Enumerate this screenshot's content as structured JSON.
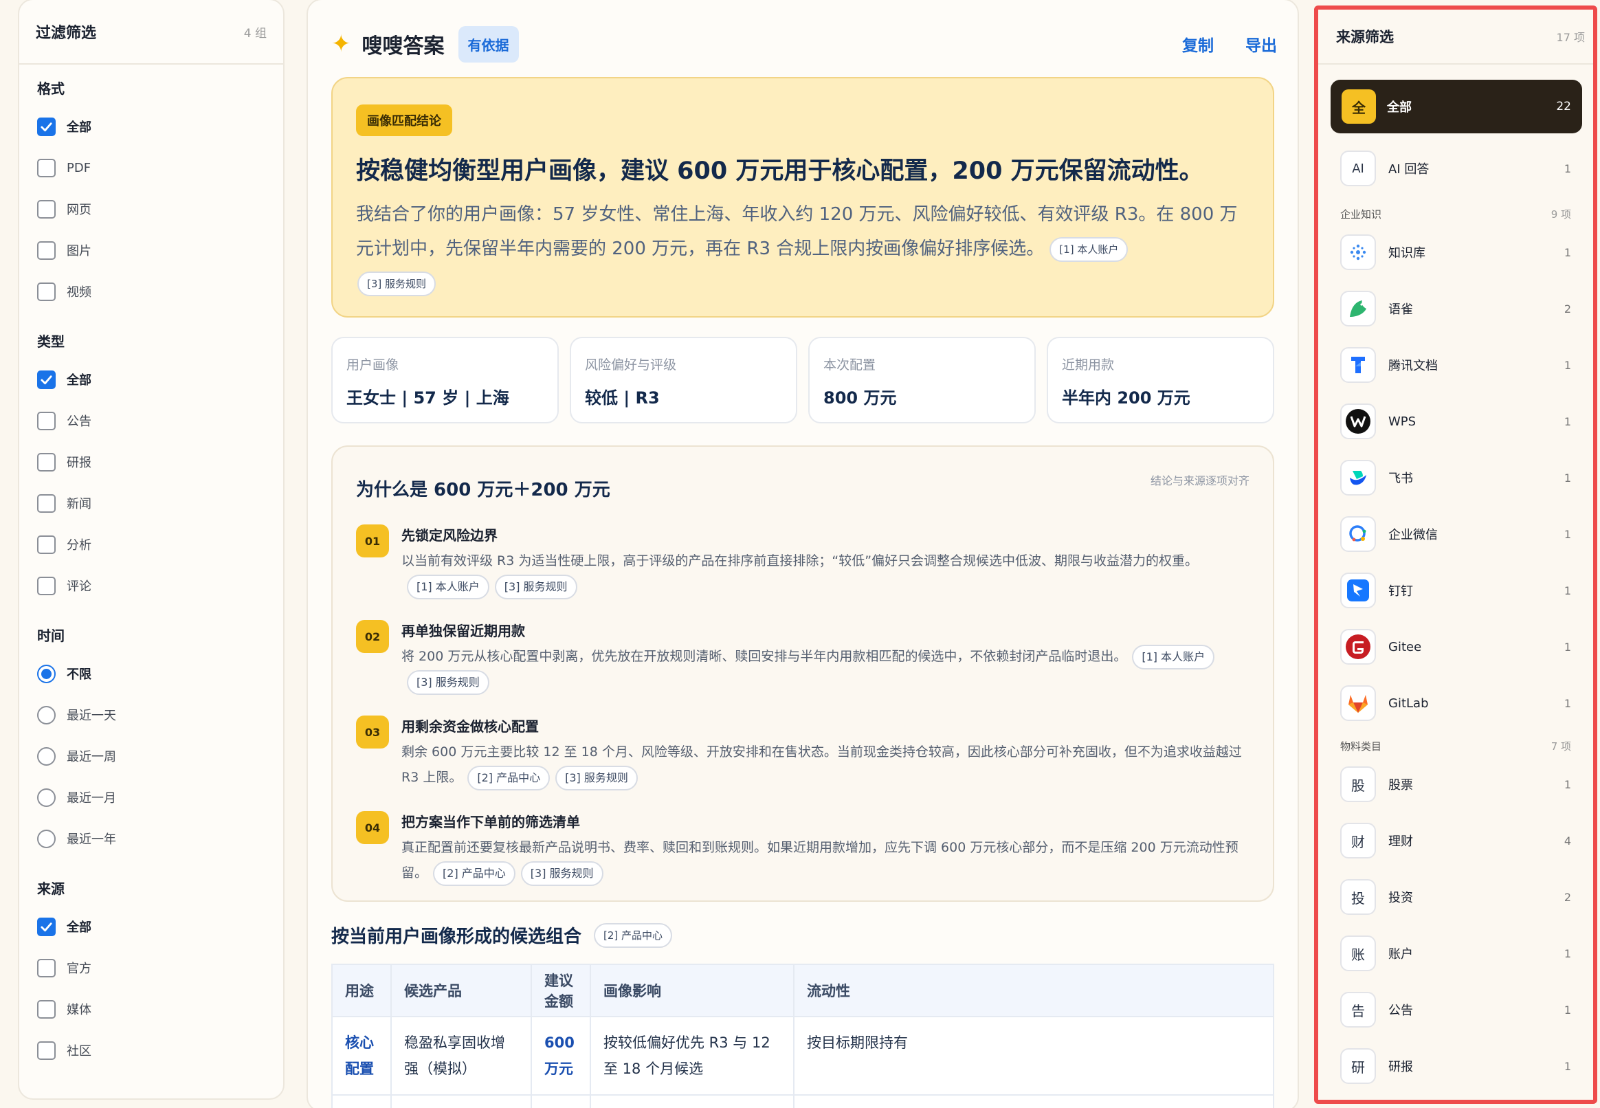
{
  "filters": {
    "title": "过滤筛选",
    "count": "4 组",
    "groups": [
      {
        "title": "格式",
        "kind": "checkbox",
        "options": [
          {
            "label": "全部",
            "checked": true
          },
          {
            "label": "PDF",
            "checked": false
          },
          {
            "label": "网页",
            "checked": false
          },
          {
            "label": "图片",
            "checked": false
          },
          {
            "label": "视频",
            "checked": false
          }
        ]
      },
      {
        "title": "类型",
        "kind": "checkbox",
        "options": [
          {
            "label": "全部",
            "checked": true
          },
          {
            "label": "公告",
            "checked": false
          },
          {
            "label": "研报",
            "checked": false
          },
          {
            "label": "新闻",
            "checked": false
          },
          {
            "label": "分析",
            "checked": false
          },
          {
            "label": "评论",
            "checked": false
          }
        ]
      },
      {
        "title": "时间",
        "kind": "radio",
        "options": [
          {
            "label": "不限",
            "checked": true
          },
          {
            "label": "最近一天",
            "checked": false
          },
          {
            "label": "最近一周",
            "checked": false
          },
          {
            "label": "最近一月",
            "checked": false
          },
          {
            "label": "最近一年",
            "checked": false
          }
        ]
      },
      {
        "title": "来源",
        "kind": "checkbox",
        "options": [
          {
            "label": "全部",
            "checked": true
          },
          {
            "label": "官方",
            "checked": false
          },
          {
            "label": "媒体",
            "checked": false
          },
          {
            "label": "社区",
            "checked": false
          }
        ]
      }
    ]
  },
  "header": {
    "title": "嗖嗖答案",
    "evidence_badge": "有依据",
    "copy_label": "复制",
    "export_label": "导出"
  },
  "conclusion": {
    "tag": "画像匹配结论",
    "headline": "按稳健均衡型用户画像，建议 600 万元用于核心配置，200 万元保留流动性。",
    "body": "我结合了你的用户画像：57 岁女性、常住上海、年收入约 120 万元、风险偏好较低、有效评级 R3。在 800 万元计划中，先保留半年内需要的 200 万元，再在 R3 合规上限内按画像偏好排序候选。",
    "citations": [
      "[1] 本人账户",
      "[3] 服务规则"
    ]
  },
  "cards": [
    {
      "label": "用户画像",
      "value": "王女士 | 57 岁 | 上海"
    },
    {
      "label": "风险偏好与评级",
      "value": "较低 | R3"
    },
    {
      "label": "本次配置",
      "value": "800 万元"
    },
    {
      "label": "近期用款",
      "value": "半年内 200 万元"
    }
  ],
  "why": {
    "title": "为什么是 600 万元＋200 万元",
    "note": "结论与来源逐项对齐",
    "steps": [
      {
        "num": "01",
        "title": "先锁定风险边界",
        "body": "以当前有效评级 R3 为适当性硬上限，高于评级的产品在排序前直接排除；“较低”偏好只会调整合规候选中低波、期限与收益潜力的权重。",
        "cites": [
          "[1] 本人账户",
          "[3] 服务规则"
        ]
      },
      {
        "num": "02",
        "title": "再单独保留近期用款",
        "body": "将 200 万元从核心配置中剥离，优先放在开放规则清晰、赎回安排与半年内用款相匹配的候选中，不依赖封闭产品临时退出。",
        "cites": [
          "[1] 本人账户",
          "[3] 服务规则"
        ]
      },
      {
        "num": "03",
        "title": "用剩余资金做核心配置",
        "body": "剩余 600 万元主要比较 12 至 18 个月、风险等级、开放安排和在售状态。当前现金类持仓较高，因此核心部分可补充固收，但不为追求收益越过 R3 上限。",
        "cites": [
          "[2] 产品中心",
          "[3] 服务规则"
        ]
      },
      {
        "num": "04",
        "title": "把方案当作下单前的筛选清单",
        "body": "真正配置前还要复核最新产品说明书、费率、赎回和到账规则。如果近期用款增加，应先下调 600 万元核心部分，而不是压缩 200 万元流动性预留。",
        "cites": [
          "[2] 产品中心",
          "[3] 服务规则"
        ]
      }
    ]
  },
  "table": {
    "title": "按当前用户画像形成的候选组合",
    "cite": "[2] 产品中心",
    "columns": [
      "用途",
      "候选产品",
      "建议金额",
      "画像影响",
      "流动性"
    ],
    "rows": [
      [
        "核心配置",
        "稳盈私享固收增强（模拟）",
        "600 万元",
        "按较低偏好优先 R3 与 12 至 18 个月候选",
        "按目标期限持有"
      ]
    ]
  },
  "sources": {
    "title": "来源筛选",
    "count": "17 项",
    "all": {
      "icon": "全",
      "label": "全部",
      "count": "22"
    },
    "ai": {
      "icon": "AI",
      "label": "AI 回答",
      "count": "1"
    },
    "sections": [
      {
        "title": "企业知识",
        "count": "9 项",
        "items": [
          {
            "icon": "knowledge-base-icon",
            "label": "知识库",
            "count": "1"
          },
          {
            "icon": "yuque-icon",
            "label": "语雀",
            "count": "2"
          },
          {
            "icon": "tencent-docs-icon",
            "label": "腾讯文档",
            "count": "1"
          },
          {
            "icon": "wps-icon",
            "label": "WPS",
            "count": "1"
          },
          {
            "icon": "feishu-icon",
            "label": "飞书",
            "count": "1"
          },
          {
            "icon": "wecom-icon",
            "label": "企业微信",
            "count": "1"
          },
          {
            "icon": "dingtalk-icon",
            "label": "钉钉",
            "count": "1"
          },
          {
            "icon": "gitee-icon",
            "label": "Gitee",
            "count": "1"
          },
          {
            "icon": "gitlab-icon",
            "label": "GitLab",
            "count": "1"
          }
        ]
      },
      {
        "title": "物料类目",
        "count": "7 项",
        "items": [
          {
            "glyph": "股",
            "label": "股票",
            "count": "1"
          },
          {
            "glyph": "财",
            "label": "理财",
            "count": "4"
          },
          {
            "glyph": "投",
            "label": "投资",
            "count": "2"
          },
          {
            "glyph": "账",
            "label": "账户",
            "count": "1"
          },
          {
            "glyph": "告",
            "label": "公告",
            "count": "1"
          },
          {
            "glyph": "研",
            "label": "研报",
            "count": "1"
          }
        ]
      }
    ]
  }
}
